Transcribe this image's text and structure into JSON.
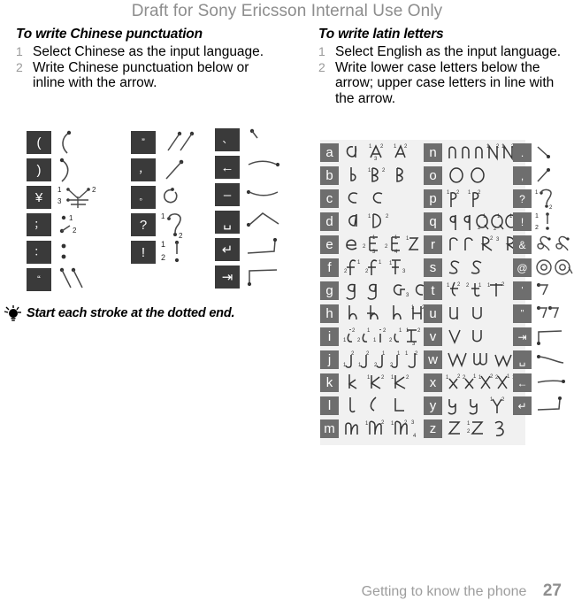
{
  "watermark": "Draft for Sony Ericsson Internal Use Only",
  "left_column": {
    "title": "To write Chinese punctuation",
    "steps": [
      {
        "num": "1",
        "text": "Select Chinese as the input language."
      },
      {
        "num": "2",
        "text": "Write Chinese punctuation below or inline with the arrow."
      }
    ]
  },
  "right_column": {
    "title": "To write latin letters",
    "steps": [
      {
        "num": "1",
        "text": "Select English as the input language."
      },
      {
        "num": "2",
        "text": "Write lower case letters below the arrow; upper case letters in line with the arrow."
      }
    ]
  },
  "tip": {
    "icon": "lightbulb-icon",
    "text": "Start each stroke at the dotted end."
  },
  "chinese_table": {
    "columns": [
      {
        "keys": [
          {
            "glyph": "(",
            "name": "left-parenthesis",
            "size": "normal"
          },
          {
            "glyph": ")",
            "name": "right-parenthesis",
            "size": "normal"
          },
          {
            "glyph": "¥",
            "name": "yuan-sign",
            "size": "normal",
            "numbered": true
          },
          {
            "glyph": "；",
            "name": "full-semicolon",
            "size": "small",
            "numbered": true
          },
          {
            "glyph": "：",
            "name": "full-colon",
            "size": "small"
          },
          {
            "glyph": "“",
            "name": "left-double-quote",
            "size": "small"
          }
        ]
      },
      {
        "keys": [
          {
            "glyph": "”",
            "name": "right-double-quote",
            "size": "small"
          },
          {
            "glyph": "，",
            "name": "full-comma",
            "size": "small"
          },
          {
            "glyph": "。",
            "name": "ideographic-period",
            "size": "tiny"
          },
          {
            "glyph": "?",
            "name": "question-mark",
            "size": "normal",
            "numbered": true
          },
          {
            "glyph": "!",
            "name": "exclamation-mark",
            "size": "normal",
            "numbered": true
          }
        ]
      },
      {
        "keys": [
          {
            "glyph": "、",
            "name": "ideographic-comma",
            "size": "small"
          },
          {
            "glyph": "←",
            "name": "backspace-key",
            "size": "normal"
          },
          {
            "glyph": "–",
            "name": "hyphen-key",
            "size": "normal"
          },
          {
            "glyph": "␣",
            "name": "space-key",
            "size": "normal"
          },
          {
            "glyph": "↵",
            "name": "enter-key",
            "size": "normal"
          },
          {
            "glyph": "⇥",
            "name": "tab-key",
            "size": "normal"
          }
        ]
      }
    ]
  },
  "latin_table": {
    "column_letters_1": [
      "a",
      "b",
      "c",
      "d",
      "e",
      "f",
      "g",
      "h",
      "i",
      "j",
      "k",
      "l",
      "m"
    ],
    "column_letters_2": [
      "n",
      "o",
      "p",
      "q",
      "r",
      "s",
      "t",
      "u",
      "v",
      "w",
      "x",
      "y",
      "z"
    ],
    "column_symbols": [
      {
        "glyph": ".",
        "name": "period-key"
      },
      {
        "glyph": ",",
        "name": "comma-key"
      },
      {
        "glyph": "?",
        "name": "question-key"
      },
      {
        "glyph": "!",
        "name": "exclamation-key"
      },
      {
        "glyph": "&",
        "name": "ampersand-key"
      },
      {
        "glyph": "@",
        "name": "at-key"
      },
      {
        "glyph": "'",
        "name": "apostrophe-key"
      },
      {
        "glyph": "\"",
        "name": "quote-key"
      },
      {
        "glyph": "⇥",
        "name": "tab-key"
      },
      {
        "glyph": "␣",
        "name": "space-key"
      },
      {
        "glyph": "←",
        "name": "backspace-key"
      },
      {
        "glyph": "↵",
        "name": "enter-key"
      }
    ]
  },
  "footer": {
    "caption": "Getting to know the phone",
    "page": "27"
  },
  "colors": {
    "watermark": "#8d8d8d",
    "key_dark": "#3a3a3a",
    "tile_gray": "#6e6e6e",
    "panel_bg": "#f1f1f1",
    "step_num": "#9a9a9a",
    "footer_text": "#9d9d9d",
    "stroke": "#4a4a4a"
  }
}
